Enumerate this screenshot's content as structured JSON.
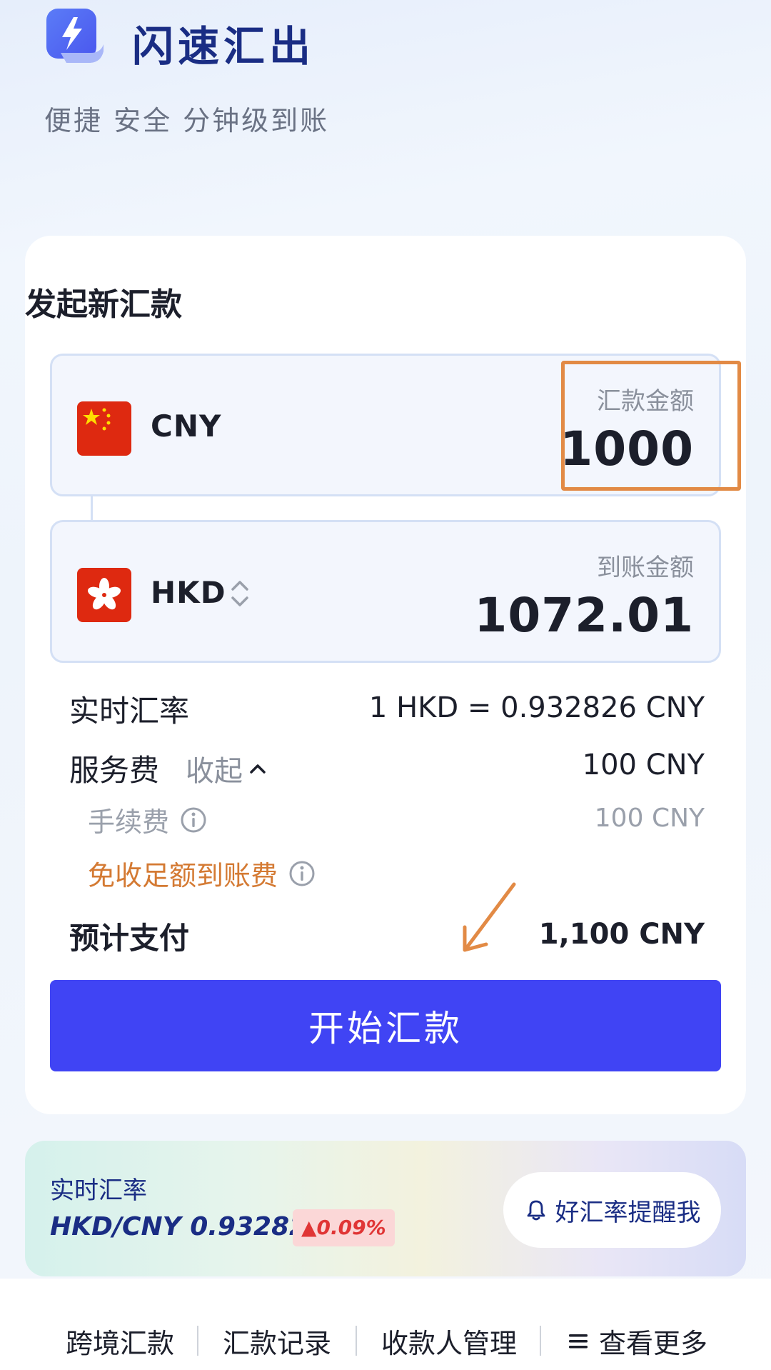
{
  "app": {
    "title": "闪速汇出",
    "slogan": "便捷 安全 分钟级到账",
    "logo_icon": "lightning-icon",
    "brand_color": "#4044f4"
  },
  "form": {
    "title": "发起新汇款",
    "source": {
      "currency": "CNY",
      "flag_icon": "china-flag-icon",
      "amount_label": "汇款金额",
      "amount": "1000"
    },
    "target": {
      "currency": "HKD",
      "flag_icon": "hong-kong-flag-icon",
      "amount_label": "到账金额",
      "amount": "1072.01",
      "swap_icon": "swap-vertical-icon"
    },
    "rate": {
      "label": "实时汇率",
      "value": "1 HKD = 0.932826 CNY"
    },
    "service_fee": {
      "label": "服务费",
      "toggle_label": "收起",
      "value": "100 CNY"
    },
    "handling_fee": {
      "label": "手续费",
      "value": "100 CNY"
    },
    "free_fee_note": "免收足额到账费",
    "total": {
      "label": "预计支付",
      "value": "1,100 CNY"
    },
    "submit_label": "开始汇款"
  },
  "rate_banner": {
    "label": "实时汇率",
    "pair_rate": "HKD/CNY 0.932826",
    "change": "▲0.09%",
    "alert_button_label": "好汇率提醒我",
    "alert_icon": "bell-icon"
  },
  "bottom_nav": {
    "items": [
      "跨境汇款",
      "汇款记录",
      "收款人管理",
      "查看更多"
    ],
    "more_icon": "menu-icon"
  }
}
